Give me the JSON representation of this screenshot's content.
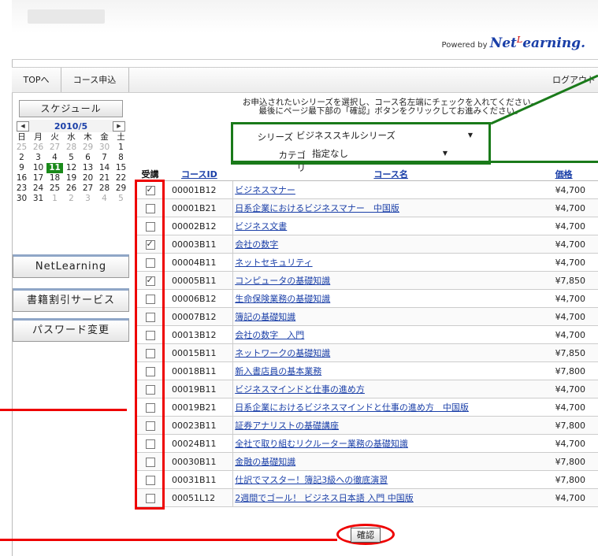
{
  "header": {
    "powered_by": "Powered by",
    "brand": "Net",
    "brand_sup": "L",
    "brand_rest": "earning."
  },
  "nav": {
    "top": "TOPへ",
    "course_apply": "コース申込",
    "logout": "ログアウト"
  },
  "calendar": {
    "title": "スケジュール",
    "month": "2010/5",
    "weekdays": [
      "日",
      "月",
      "火",
      "水",
      "木",
      "金",
      "土"
    ],
    "weeks": [
      [
        "25",
        "26",
        "27",
        "28",
        "29",
        "30",
        "1"
      ],
      [
        "2",
        "3",
        "4",
        "5",
        "6",
        "7",
        "8"
      ],
      [
        "9",
        "10",
        "11",
        "12",
        "13",
        "14",
        "15"
      ],
      [
        "16",
        "17",
        "18",
        "19",
        "20",
        "21",
        "22"
      ],
      [
        "23",
        "24",
        "25",
        "26",
        "27",
        "28",
        "29"
      ],
      [
        "30",
        "31",
        "1",
        "2",
        "3",
        "4",
        "5"
      ]
    ],
    "today": "11"
  },
  "sidebar": {
    "netlearning": "NetLearning",
    "books": "書籍割引サービス",
    "password": "パスワード変更"
  },
  "instructions": {
    "line1": "お申込されたいシリーズを選択し、コース名左端にチェックを入れてください。",
    "line2": "最後にページ最下部の「確認」ボタンをクリックしてお進みください。"
  },
  "filters": {
    "series_label": "シリーズ",
    "series_value": "ビジネススキルシリーズ",
    "category_label": "カテゴリ",
    "category_value": "指定なし"
  },
  "table": {
    "headers": {
      "check": "受講",
      "id": "コースID",
      "name": "コース名",
      "price": "価格"
    },
    "rows": [
      {
        "checked": true,
        "id": "00001B12",
        "name": "ビジネスマナー",
        "price": "¥4,700"
      },
      {
        "checked": false,
        "id": "00001B21",
        "name": "日系企業におけるビジネスマナー　中国版",
        "price": "¥4,700"
      },
      {
        "checked": false,
        "id": "00002B12",
        "name": "ビジネス文書",
        "price": "¥4,700"
      },
      {
        "checked": true,
        "id": "00003B11",
        "name": "会社の数字",
        "price": "¥4,700"
      },
      {
        "checked": false,
        "id": "00004B11",
        "name": "ネットセキュリティ",
        "price": "¥4,700"
      },
      {
        "checked": true,
        "id": "00005B11",
        "name": "コンピュータの基礎知識",
        "price": "¥7,850"
      },
      {
        "checked": false,
        "id": "00006B12",
        "name": "生命保険業務の基礎知識",
        "price": "¥4,700"
      },
      {
        "checked": false,
        "id": "00007B12",
        "name": "簿記の基礎知識",
        "price": "¥4,700"
      },
      {
        "checked": false,
        "id": "00013B12",
        "name": "会社の数字　入門",
        "price": "¥4,700"
      },
      {
        "checked": false,
        "id": "00015B11",
        "name": "ネットワークの基礎知識",
        "price": "¥7,850"
      },
      {
        "checked": false,
        "id": "00018B11",
        "name": "新入書店員の基本業務",
        "price": "¥7,800"
      },
      {
        "checked": false,
        "id": "00019B11",
        "name": "ビジネスマインドと仕事の進め方",
        "price": "¥4,700"
      },
      {
        "checked": false,
        "id": "00019B21",
        "name": "日系企業におけるビジネスマインドと仕事の進め方　中国版",
        "price": "¥4,700"
      },
      {
        "checked": false,
        "id": "00023B11",
        "name": "証券アナリストの基礎講座",
        "price": "¥7,800"
      },
      {
        "checked": false,
        "id": "00024B11",
        "name": "全社で取り組むリクルーター業務の基礎知識",
        "price": "¥4,700"
      },
      {
        "checked": false,
        "id": "00030B11",
        "name": "金融の基礎知識",
        "price": "¥7,800"
      },
      {
        "checked": false,
        "id": "00031B11",
        "name": "仕訳でマスター！簿記3級への徹底演習",
        "price": "¥7,800"
      },
      {
        "checked": false,
        "id": "00051L12",
        "name": "2週間でゴール！ ビジネス日本語 入門 中国版",
        "price": "¥4,700"
      }
    ]
  },
  "confirm_button": "確認",
  "colors": {
    "accent_red": "#e00000",
    "accent_green": "#1a7a1a",
    "link_blue": "#1a3fa8"
  }
}
